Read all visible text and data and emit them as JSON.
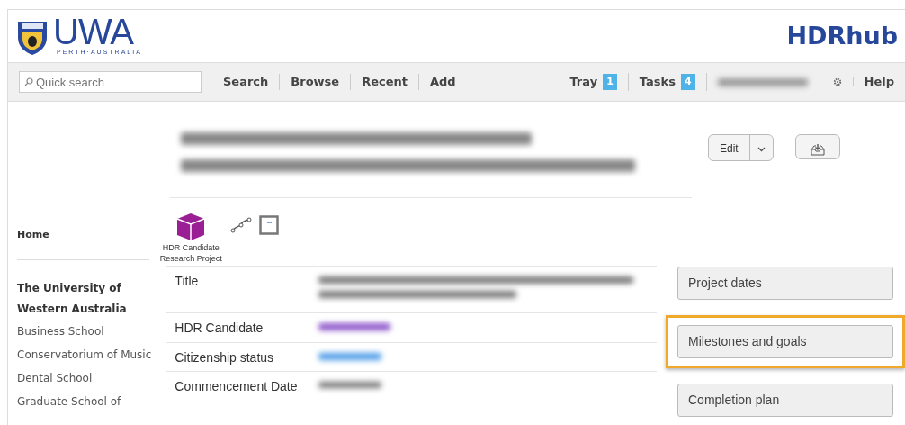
{
  "header": {
    "logo_text": "UWA",
    "logo_subtext": "PERTH·AUSTRALIA",
    "app_title": "HDRhub"
  },
  "toolbar": {
    "search": {
      "placeholder": "Quick search"
    },
    "links": [
      {
        "label": "Search"
      },
      {
        "label": "Browse"
      },
      {
        "label": "Recent"
      },
      {
        "label": "Add"
      }
    ],
    "counters": [
      {
        "label": "Tray",
        "count": "1"
      },
      {
        "label": "Tasks",
        "count": "4"
      }
    ],
    "help": "Help"
  },
  "actions": {
    "edit": "Edit"
  },
  "sidebar": {
    "home": "Home",
    "heading": "The University of Western Australia",
    "items": [
      "Business School",
      "Conservatorium of Music",
      "Dental School",
      "Graduate School of"
    ]
  },
  "record": {
    "type_label": "HDR Candidate Research Project",
    "fields": [
      {
        "label": "Title",
        "kind": "text"
      },
      {
        "label": "HDR Candidate",
        "kind": "person"
      },
      {
        "label": "Citizenship status",
        "kind": "link"
      },
      {
        "label": "Commencement Date",
        "kind": "text"
      }
    ]
  },
  "panels": [
    {
      "label": "Project dates",
      "selected": false
    },
    {
      "label": "Milestones and goals",
      "selected": true
    },
    {
      "label": "Completion plan",
      "selected": false
    }
  ]
}
